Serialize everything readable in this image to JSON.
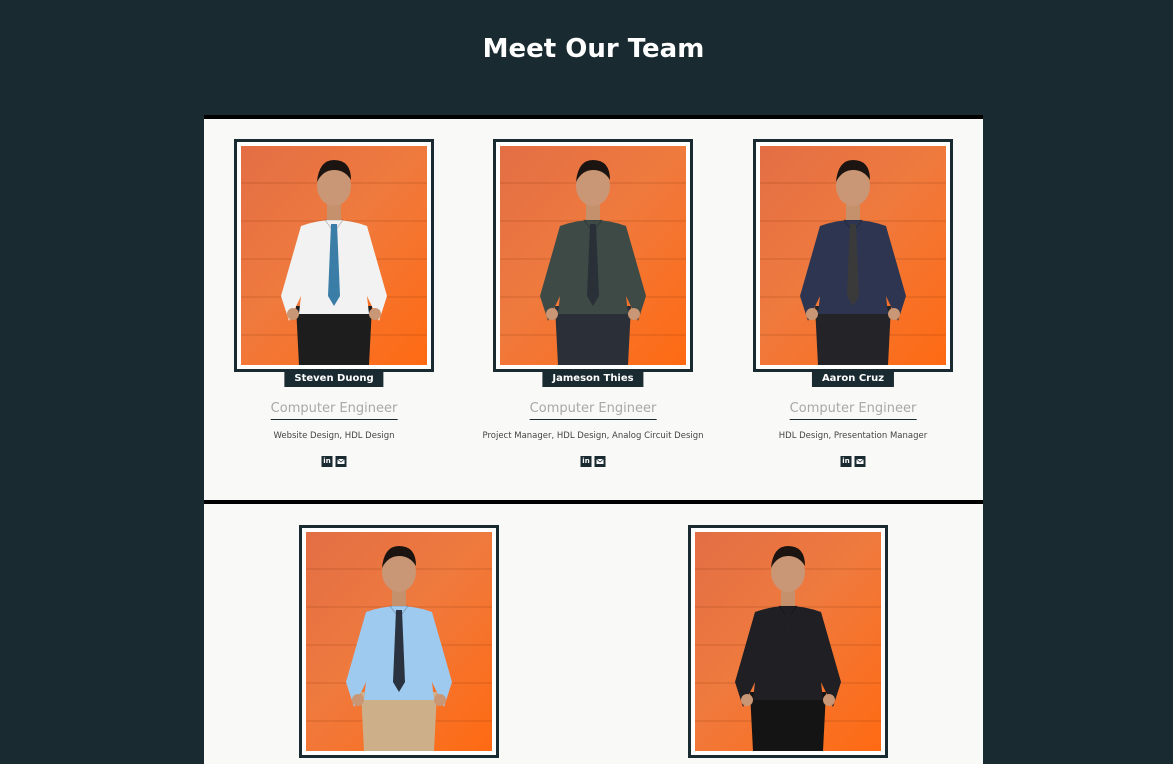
{
  "header": {
    "title": "Meet Our Team"
  },
  "team": [
    {
      "name": "Steven Duong",
      "role": "Computer Engineer",
      "skills": "Website Design, HDL Design",
      "shirt": "#f2f2f2",
      "tie": "#3a7ea8",
      "pants": "#1d1d1d"
    },
    {
      "name": "Jameson Thies",
      "role": "Computer Engineer",
      "skills": "Project Manager, HDL Design, Analog Circuit Design",
      "shirt": "#3e4a46",
      "tie": "#2a3038",
      "pants": "#2b3038"
    },
    {
      "name": "Aaron Cruz",
      "role": "Computer Engineer",
      "skills": "HDL Design, Presentation Manager",
      "shirt": "#2e3550",
      "tie": "#3a3a3a",
      "pants": "#232328"
    },
    {
      "name": "",
      "role": "",
      "skills": "",
      "shirt": "#9fcaef",
      "tie": "#2a3240",
      "pants": "#cdb08a"
    },
    {
      "name": "",
      "role": "",
      "skills": "",
      "shirt": "#1f1f24",
      "tie": "#1f1f24",
      "pants": "#141414"
    }
  ],
  "social_icons": [
    "linkedin-icon",
    "email-icon"
  ],
  "colors": {
    "background": "#1a2a31",
    "panel": "#f9f9f7",
    "accent": "#1a2a31",
    "photo_wall": "#ef7a3e"
  }
}
